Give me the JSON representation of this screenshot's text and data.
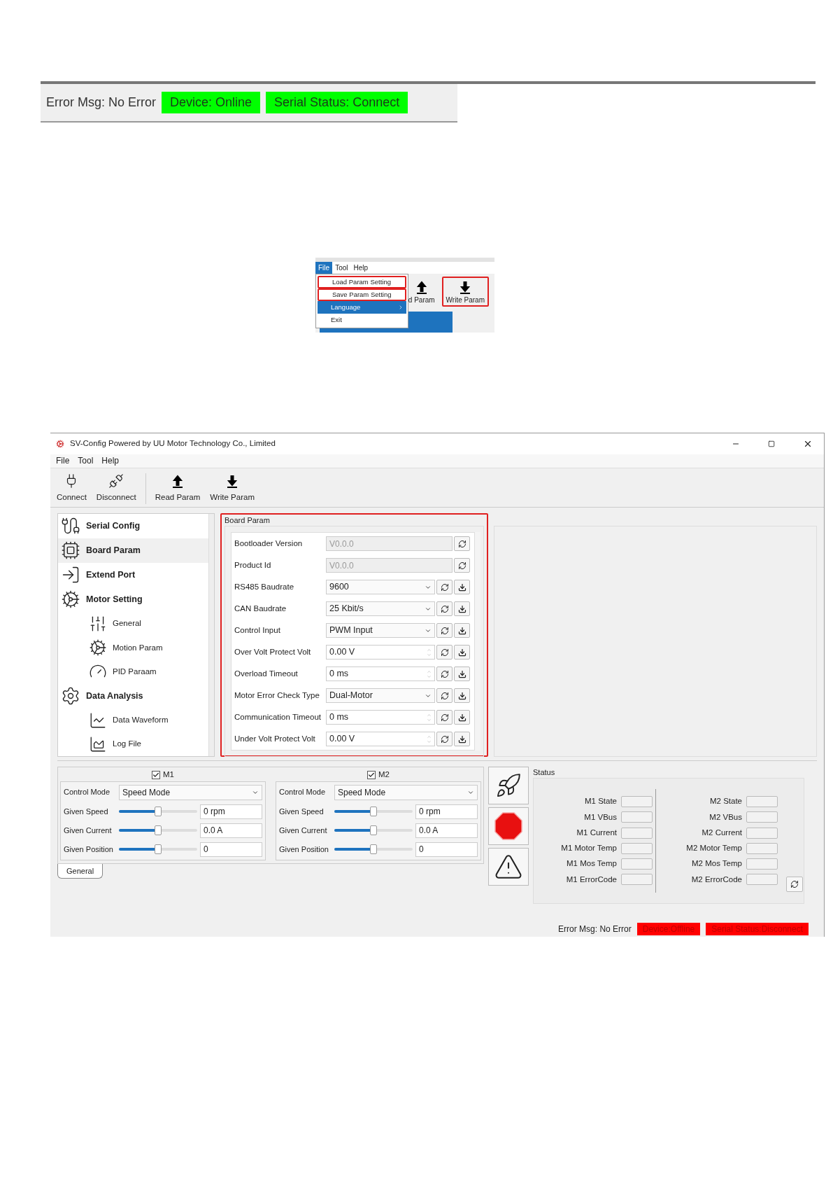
{
  "top_status": {
    "error_msg": "Error Msg: No Error",
    "device": {
      "text": "Device: Online",
      "color": "#00ff00"
    },
    "serial": {
      "text": "Serial Status: Connect",
      "color": "#00ff00"
    }
  },
  "menu_snippet": {
    "menus": [
      {
        "label": "File",
        "selected": true
      },
      {
        "label": "Tool",
        "selected": false
      },
      {
        "label": "Help",
        "selected": false
      }
    ],
    "items": [
      {
        "label": "Load Param Setting",
        "outlined": true,
        "selected": false,
        "submenu": false
      },
      {
        "label": "Save Param Setting",
        "outlined": true,
        "selected": false,
        "submenu": false
      },
      {
        "label": "Language",
        "outlined": false,
        "selected": true,
        "submenu": true
      },
      {
        "label": "Exit",
        "outlined": false,
        "selected": false,
        "submenu": false
      }
    ],
    "toolbar": [
      {
        "label": "d Param",
        "kind": "up",
        "outlined": false
      },
      {
        "label": "Write Param",
        "kind": "down",
        "outlined": true
      }
    ]
  },
  "window": {
    "title": "SV-Config Powered by UU Motor Technology Co., Limited",
    "menus": [
      "File",
      "Tool",
      "Help"
    ],
    "toolbar": [
      {
        "label": "Connect",
        "kind": "plug"
      },
      {
        "label": "Disconnect",
        "kind": "unplug"
      },
      {
        "label": "Read Param",
        "kind": "up"
      },
      {
        "label": "Write Param",
        "kind": "down"
      }
    ],
    "sidebar": {
      "items": [
        {
          "label": "Serial Config",
          "selected": false
        },
        {
          "label": "Board Param",
          "selected": true
        },
        {
          "label": "Extend Port",
          "selected": false
        },
        {
          "label": "Motor Setting",
          "selected": false,
          "children": [
            {
              "label": "General",
              "selected": false
            },
            {
              "label": "Motion Param",
              "selected": false
            },
            {
              "label": "PID Paraam",
              "selected": false
            }
          ]
        },
        {
          "label": "Data Analysis",
          "selected": false,
          "children": [
            {
              "label": "Data Waveform",
              "selected": false
            },
            {
              "label": "Log File",
              "selected": false
            }
          ]
        }
      ]
    },
    "board_param": {
      "title": "Board Param",
      "rows": [
        {
          "label": "Bootloader Version",
          "kind": "readonly",
          "value": "V0.0.0"
        },
        {
          "label": "Product Id",
          "kind": "readonly",
          "value": "V0.0.0"
        },
        {
          "label": "RS485 Baudrate",
          "kind": "select",
          "value": "9600"
        },
        {
          "label": "CAN Baudrate",
          "kind": "select",
          "value": "25 Kbit/s"
        },
        {
          "label": "Control Input",
          "kind": "select",
          "value": "PWM Input"
        },
        {
          "label": "Over Volt Protect Volt",
          "kind": "spin",
          "value": "0.00 V"
        },
        {
          "label": "Overload Timeout",
          "kind": "spin",
          "value": "0 ms"
        },
        {
          "label": "Motor Error Check Type",
          "kind": "select",
          "value": "Dual-Motor"
        },
        {
          "label": "Communication Timeout",
          "kind": "spin",
          "value": "0 ms"
        },
        {
          "label": "Under Volt Protect Volt",
          "kind": "spin",
          "value": "0.00 V"
        }
      ]
    },
    "motors": [
      {
        "name": "M1",
        "checked": true,
        "control_mode_label": "Control Mode",
        "control_mode": "Speed Mode",
        "sliders": [
          {
            "label": "Given Speed",
            "level": 0.5,
            "value": "0 rpm"
          },
          {
            "label": "Given Current",
            "level": 0.5,
            "value": "0.0 A"
          },
          {
            "label": "Given Position",
            "level": 0.5,
            "value": "0"
          }
        ]
      },
      {
        "name": "M2",
        "checked": true,
        "control_mode_label": "Control Mode",
        "control_mode": "Speed Mode",
        "sliders": [
          {
            "label": "Given Speed",
            "level": 0.5,
            "value": "0 rpm"
          },
          {
            "label": "Given Current",
            "level": 0.5,
            "value": "0.0 A"
          },
          {
            "label": "Given Position",
            "level": 0.5,
            "value": "0"
          }
        ]
      }
    ],
    "bottom_tab": {
      "label": "General",
      "selected": true
    },
    "status": {
      "title": "Status",
      "columns": [
        [
          "M1 State",
          "M1 VBus",
          "M1 Current",
          "M1 Motor Temp",
          "M1 Mos Temp",
          "M1 ErrorCode"
        ],
        [
          "M2 State",
          "M2 VBus",
          "M2 Current",
          "M2 Motor Temp",
          "M2 Mos Temp",
          "M2 ErrorCode"
        ]
      ]
    },
    "status_bar": {
      "error_msg": "Error Msg: No Error",
      "device": {
        "text": "Device:Offline",
        "color": "#ff0000"
      },
      "serial": {
        "text": "Serial Status:Disconnect",
        "color": "#ff0000"
      }
    }
  }
}
